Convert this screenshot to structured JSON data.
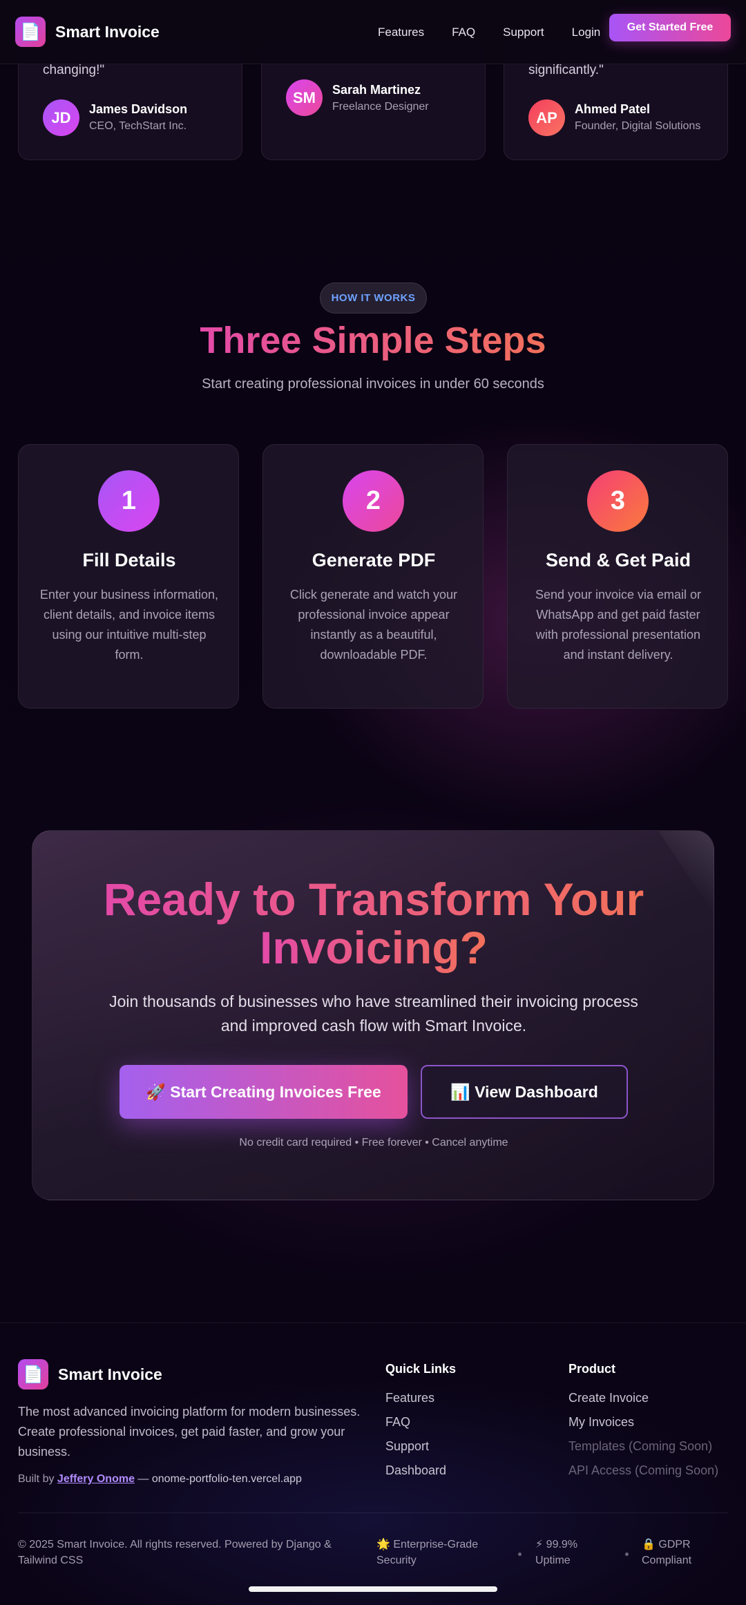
{
  "nav": {
    "brand": "Smart Invoice",
    "logo_icon": "📄",
    "links": [
      "Features",
      "FAQ",
      "Support",
      "Login"
    ],
    "cta": "Get Started Free"
  },
  "testimonials": [
    {
      "quote_tail": "changing!\"",
      "initials": "JD",
      "name": "James Davidson",
      "role": "CEO, TechStart Inc."
    },
    {
      "quote_tail": "",
      "initials": "SM",
      "name": "Sarah Martinez",
      "role": "Freelance Designer"
    },
    {
      "quote_tail": "significantly.\"",
      "initials": "AP",
      "name": "Ahmed Patel",
      "role": "Founder, Digital Solutions"
    }
  ],
  "how": {
    "pill": "HOW IT WORKS",
    "title": "Three Simple Steps",
    "subtitle": "Start creating professional invoices in under 60 seconds",
    "steps": [
      {
        "num": "1",
        "title": "Fill Details",
        "text": "Enter your business information, client details, and invoice items using our intuitive multi-step form."
      },
      {
        "num": "2",
        "title": "Generate PDF",
        "text": "Click generate and watch your professional invoice appear instantly as a beautiful, downloadable PDF."
      },
      {
        "num": "3",
        "title": "Send & Get Paid",
        "text": "Send your invoice via email or WhatsApp and get paid faster with professional presentation and instant delivery."
      }
    ]
  },
  "cta": {
    "title_line1": "Ready to Transform Your",
    "title_line2": "Invoicing?",
    "subtitle": "Join thousands of businesses who have streamlined their invoicing process and improved cash flow with Smart Invoice.",
    "primary": "🚀 Start Creating Invoices Free",
    "secondary": "📊 View Dashboard",
    "note": "No credit card required • Free forever • Cancel anytime"
  },
  "footer": {
    "brand": "Smart Invoice",
    "logo_icon": "📄",
    "description": "The most advanced invoicing platform for modern businesses. Create professional invoices, get paid faster, and grow your business.",
    "built_prefix": "Built by",
    "built_name": "Jeffery Onome",
    "built_sep": "—",
    "built_site": "onome-portfolio-ten.vercel.app",
    "quick_links_heading": "Quick Links",
    "quick_links": [
      "Features",
      "FAQ",
      "Support",
      "Dashboard"
    ],
    "product_heading": "Product",
    "product_links": [
      "Create Invoice",
      "My Invoices"
    ],
    "product_coming": [
      "Templates (Coming Soon)",
      "API Access (Coming Soon)"
    ],
    "copyright": "© 2025 Smart Invoice. All rights reserved. Powered by Django & Tailwind CSS",
    "badges": [
      "🌟 Enterprise-Grade Security",
      "⚡ 99.9% Uptime",
      "🔒 GDPR Compliant"
    ]
  }
}
